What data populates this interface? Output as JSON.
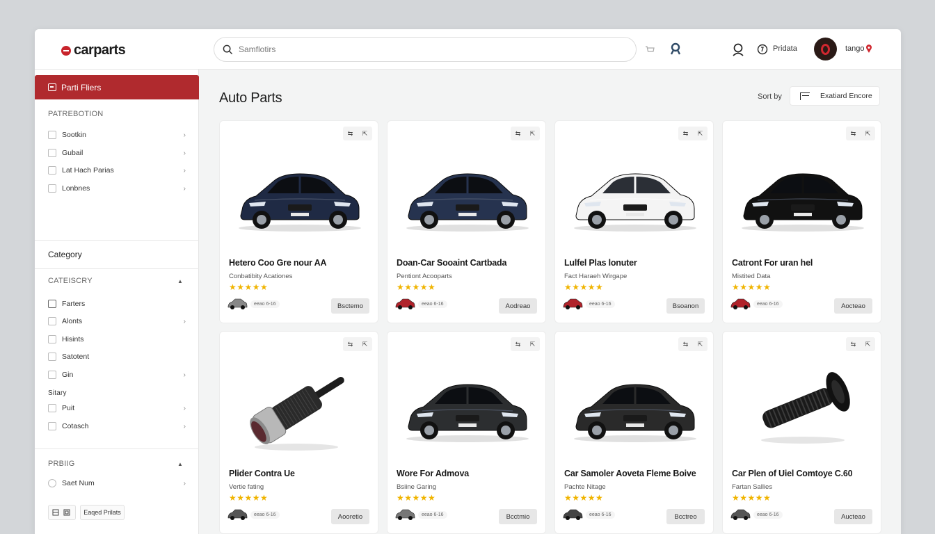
{
  "app": {
    "logo": "carparts",
    "search_placeholder": "Samflotirs",
    "menu_label": "Pridata",
    "user_label": "tango"
  },
  "sidebar": {
    "header": "Parti Fliers",
    "section1_title": "PATREBOTION",
    "section1_items": [
      {
        "label": "Sootkin"
      },
      {
        "label": "Gubail"
      },
      {
        "label": "Lat Hach Parias"
      },
      {
        "label": "Lonbnes"
      }
    ],
    "category_title": "Category",
    "section2_title": "CATEISCRY",
    "section2_items": [
      {
        "label": "Farters"
      },
      {
        "label": "Alonts"
      },
      {
        "label": "Hisints"
      },
      {
        "label": "Satotent"
      },
      {
        "label": "Gin"
      }
    ],
    "section3_title": "Sitary",
    "section3_items": [
      {
        "label": "Puit"
      },
      {
        "label": "Cotasch"
      }
    ],
    "section4_title": "PRBIIG",
    "section4_items": [
      {
        "label": "Saet Num"
      }
    ],
    "bottom_button": "Eaqed Prilats"
  },
  "main": {
    "title": "Auto Parts",
    "sort_label": "Sort by",
    "sort_value": "Exatiard Encore"
  },
  "products": [
    {
      "title": "Hetero Coo Gre nour AA",
      "subtitle": "Conbatibity Acationes",
      "stars": "★★★★★",
      "meta": "eeao 6-16",
      "button": "Bsctemo",
      "color": "#1f2a44",
      "kind": "car"
    },
    {
      "title": "Doan-Car Sooaint Cartbada",
      "subtitle": "Pentiont Acooparts",
      "stars": "★★★★★",
      "meta": "eeao 6-16",
      "button": "Aodreao",
      "color": "#26334f",
      "kind": "car"
    },
    {
      "title": "Lulfel Plas lonuter",
      "subtitle": "Fact Haraeh Wirgape",
      "stars": "★★★★★",
      "meta": "eeao 6-16",
      "button": "Bsoanon",
      "color": "#f4f4f4",
      "kind": "car"
    },
    {
      "title": "Catront For uran hel",
      "subtitle": "Mistited Data",
      "stars": "★★★★★",
      "meta": "eeao 6-16",
      "button": "Aocteao",
      "color": "#111111",
      "kind": "car"
    },
    {
      "title": "Plider Contra Ue",
      "subtitle": "Vertie fating",
      "stars": "★★★★★",
      "meta": "eeao 6-16",
      "button": "Aooretio",
      "color": "#3a3a3a",
      "kind": "part"
    },
    {
      "title": "Wore For Admova",
      "subtitle": "Bsiine Garing",
      "stars": "★★★★★",
      "meta": "eeao 6-16",
      "button": "Bcctmio",
      "color": "#2c2e30",
      "kind": "car"
    },
    {
      "title": "Car Samoler Aoveta Fleme Boive",
      "subtitle": "Pachte Nitage",
      "stars": "★★★★★",
      "meta": "eeao 6-16",
      "button": "Bcctreo",
      "color": "#2a2a2a",
      "kind": "car"
    },
    {
      "title": "Car Plen of Uiel Comtoye C.60",
      "subtitle": "Fartan Sallies",
      "stars": "★★★★★",
      "meta": "eeao 6-16",
      "button": "Aucteao",
      "color": "#1c1c1c",
      "kind": "bolt"
    }
  ]
}
